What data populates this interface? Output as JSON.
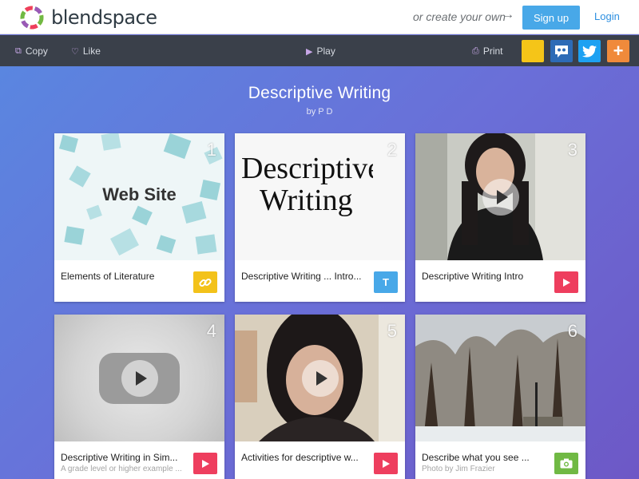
{
  "header": {
    "logo_text": "blendspace",
    "create_text": "or create your own",
    "signup_label": "Sign up",
    "login_label": "Login"
  },
  "toolbar": {
    "copy_label": "Copy",
    "like_label": "Like",
    "play_label": "Play",
    "print_label": "Print",
    "plus_label": "+"
  },
  "lesson": {
    "title": "Descriptive Writing",
    "author": "by P D"
  },
  "cards": [
    {
      "number": "1",
      "title": "Elements of Literature",
      "subtitle": "",
      "thumb_text": "Web Site",
      "badge": "link-icon"
    },
    {
      "number": "2",
      "title": "Descriptive Writing ... Intro...",
      "subtitle": "",
      "thumb_text_1": "Descriptive",
      "thumb_text_2": "Writing",
      "badge_text": "T"
    },
    {
      "number": "3",
      "title": "Descriptive Writing Intro",
      "subtitle": "",
      "badge": "video-icon"
    },
    {
      "number": "4",
      "title": "Descriptive Writing in Sim...",
      "subtitle": "A grade level or higher example ...",
      "badge": "video-icon"
    },
    {
      "number": "5",
      "title": "Activities for descriptive w...",
      "subtitle": "",
      "badge": "video-icon"
    },
    {
      "number": "6",
      "title": "Describe what you see ...",
      "subtitle": "Photo by Jim Frazier",
      "badge": "camera-icon"
    }
  ],
  "colors": {
    "brand_blue": "#48a8e8",
    "toolbar": "#3a404a",
    "badge_yellow": "#f3c21a",
    "badge_red": "#ee3e5e",
    "badge_green": "#70b944"
  }
}
